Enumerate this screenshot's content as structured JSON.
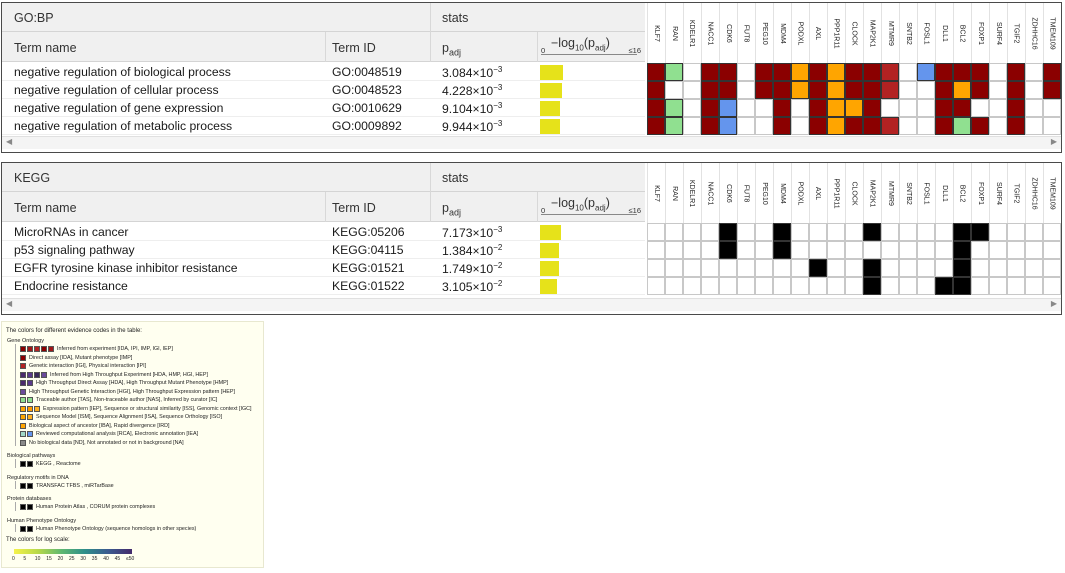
{
  "genes": [
    "KLF7",
    "RAN",
    "KDELR1",
    "NACC1",
    "CDK6",
    "FUT8",
    "PEG10",
    "MDM4",
    "PODXL",
    "AXL",
    "PPP1R11",
    "CLOCK",
    "MAP2K1",
    "MTMR9",
    "SNTB2",
    "FOSL1",
    "DLL1",
    "BCL2",
    "FOXP1",
    "SURF4",
    "TGIF2",
    "ZDHHC16",
    "TMEM109"
  ],
  "columns": {
    "term_name": "Term name",
    "term_id": "Term ID",
    "padj": "p",
    "padj_sub": "adj",
    "log_prefix": "−log",
    "log_sub": "10",
    "log_mid": "(p",
    "log_sub2": "adj",
    "log_suffix": ")",
    "axis_zero": "0",
    "axis_max": "≤16"
  },
  "go_panel": {
    "source": "GO:BP",
    "stats": "stats",
    "rows": [
      {
        "name": "negative regulation of biological process",
        "id": "GO:0048519",
        "p_mant": "3.084×10",
        "p_exp": "−3",
        "log10p": 2.51
      },
      {
        "name": "negative regulation of cellular process",
        "id": "GO:0048523",
        "p_mant": "4.228×10",
        "p_exp": "−3",
        "log10p": 2.37
      },
      {
        "name": "negative regulation of gene expression",
        "id": "GO:0010629",
        "p_mant": "9.104×10",
        "p_exp": "−3",
        "log10p": 2.04
      },
      {
        "name": "negative regulation of metabolic process",
        "id": "GO:0009892",
        "p_mant": "9.944×10",
        "p_exp": "−3",
        "log10p": 2.0
      }
    ],
    "grid": [
      [
        "#8b0000",
        "#90e090",
        "#ffffff",
        "#8b0000",
        "#8b0000",
        "#ffffff",
        "#8b0000",
        "#8b0000",
        "#ffa500",
        "#8b0000",
        "#ffa500",
        "#8b0000",
        "#8b0000",
        "#b22222",
        "#ffffff",
        "#6495ed",
        "#8b0000",
        "#8b0000",
        "#8b0000",
        "#ffffff",
        "#8b0000",
        "#ffffff",
        "#8b0000"
      ],
      [
        "#8b0000",
        "#ffffff",
        "#ffffff",
        "#8b0000",
        "#8b0000",
        "#ffffff",
        "#8b0000",
        "#8b0000",
        "#ffa500",
        "#8b0000",
        "#ffa500",
        "#8b0000",
        "#8b0000",
        "#b22222",
        "#ffffff",
        "#ffffff",
        "#8b0000",
        "#ffa500",
        "#8b0000",
        "#ffffff",
        "#8b0000",
        "#ffffff",
        "#8b0000"
      ],
      [
        "#8b0000",
        "#90e090",
        "#ffffff",
        "#8b0000",
        "#6495ed",
        "#ffffff",
        "#ffffff",
        "#8b0000",
        "#ffffff",
        "#8b0000",
        "#ffa500",
        "#ffa500",
        "#8b0000",
        "#ffffff",
        "#ffffff",
        "#ffffff",
        "#8b0000",
        "#8b0000",
        "#ffffff",
        "#ffffff",
        "#8b0000",
        "#ffffff",
        "#ffffff"
      ],
      [
        "#8b0000",
        "#90e090",
        "#ffffff",
        "#8b0000",
        "#6495ed",
        "#ffffff",
        "#ffffff",
        "#8b0000",
        "#ffffff",
        "#8b0000",
        "#ffa500",
        "#8b0000",
        "#8b0000",
        "#b22222",
        "#ffffff",
        "#ffffff",
        "#8b0000",
        "#90e090",
        "#8b0000",
        "#ffffff",
        "#8b0000",
        "#ffffff",
        "#ffffff"
      ]
    ]
  },
  "kegg_panel": {
    "source": "KEGG",
    "stats": "stats",
    "rows": [
      {
        "name": "MicroRNAs in cancer",
        "id": "KEGG:05206",
        "p_mant": "7.173×10",
        "p_exp": "−3",
        "log10p": 2.14
      },
      {
        "name": "p53 signaling pathway",
        "id": "KEGG:04115",
        "p_mant": "1.384×10",
        "p_exp": "−2",
        "log10p": 1.86
      },
      {
        "name": "EGFR tyrosine kinase inhibitor resistance",
        "id": "KEGG:01521",
        "p_mant": "1.749×10",
        "p_exp": "−2",
        "log10p": 1.76
      },
      {
        "name": "Endocrine resistance",
        "id": "KEGG:01522",
        "p_mant": "3.105×10",
        "p_exp": "−2",
        "log10p": 1.51
      }
    ],
    "grid": [
      [
        "#ffffff",
        "#ffffff",
        "#ffffff",
        "#ffffff",
        "#000000",
        "#ffffff",
        "#ffffff",
        "#000000",
        "#ffffff",
        "#ffffff",
        "#ffffff",
        "#ffffff",
        "#000000",
        "#ffffff",
        "#ffffff",
        "#ffffff",
        "#ffffff",
        "#000000",
        "#000000",
        "#ffffff",
        "#ffffff",
        "#ffffff",
        "#ffffff"
      ],
      [
        "#ffffff",
        "#ffffff",
        "#ffffff",
        "#ffffff",
        "#000000",
        "#ffffff",
        "#ffffff",
        "#000000",
        "#ffffff",
        "#ffffff",
        "#ffffff",
        "#ffffff",
        "#ffffff",
        "#ffffff",
        "#ffffff",
        "#ffffff",
        "#ffffff",
        "#000000",
        "#ffffff",
        "#ffffff",
        "#ffffff",
        "#ffffff",
        "#ffffff"
      ],
      [
        "#ffffff",
        "#ffffff",
        "#ffffff",
        "#ffffff",
        "#ffffff",
        "#ffffff",
        "#ffffff",
        "#ffffff",
        "#ffffff",
        "#000000",
        "#ffffff",
        "#ffffff",
        "#000000",
        "#ffffff",
        "#ffffff",
        "#ffffff",
        "#ffffff",
        "#000000",
        "#ffffff",
        "#ffffff",
        "#ffffff",
        "#ffffff",
        "#ffffff"
      ],
      [
        "#ffffff",
        "#ffffff",
        "#ffffff",
        "#ffffff",
        "#ffffff",
        "#ffffff",
        "#ffffff",
        "#ffffff",
        "#ffffff",
        "#ffffff",
        "#ffffff",
        "#ffffff",
        "#000000",
        "#ffffff",
        "#ffffff",
        "#ffffff",
        "#000000",
        "#000000",
        "#ffffff",
        "#ffffff",
        "#ffffff",
        "#ffffff",
        "#ffffff"
      ]
    ]
  },
  "legend": {
    "title": "The colors for different evidence codes in the table:",
    "groups": [
      {
        "name": "Gene Ontology",
        "items": [
          {
            "colors": [
              "#8b0000",
              "#a01818",
              "#b22222",
              "#8b0000",
              "#a01818"
            ],
            "label": "Inferred from experiment [IDA, IPI, IMP, IGI, IEP]"
          },
          {
            "colors": [
              "#8b0000"
            ],
            "label": "Direct assay [IDA], Mutant phenotype [IMP]"
          },
          {
            "colors": [
              "#b22222"
            ],
            "label": "Genetic interaction [IGI], Physical interaction [IPI]"
          },
          {
            "colors": [
              "#4b2a6b",
              "#5a3a8a",
              "#3b2a5b",
              "#6a4a9a"
            ],
            "label": "Inferred from High Throughput Experiment [HDA, HMP, HGI, HEP]"
          },
          {
            "colors": [
              "#4b2a6b",
              "#5a3a8a"
            ],
            "label": "High Throughput Direct Assay [HDA], High Throughput Mutant Phenotype [HMP]"
          },
          {
            "colors": [
              "#6a4a9a"
            ],
            "label": "High Throughput Genetic Interaction [HGI], High Throughput Expression pattern [HEP]"
          },
          {
            "colors": [
              "#90e090",
              "#90e090"
            ],
            "label": "Traceable author [TAS], Non-traceable author [NAS], Inferred by curator [IC]"
          },
          {
            "colors": [
              "#ffa500",
              "#ff9a00",
              "#ffb020"
            ],
            "label": "Expression pattern [IEP], Sequence or structural similarity [ISS], Genomic context [IGC]"
          },
          {
            "colors": [
              "#ffa500",
              "#ffb020"
            ],
            "label": "Sequence Model [ISM], Sequence Alignment [ISA], Sequence Orthology [ISO]"
          },
          {
            "colors": [
              "#ffa500"
            ],
            "label": "Biological aspect of ancestor [IBA], Rapid divergence [IRD]"
          },
          {
            "colors": [
              "#a0d8c8",
              "#6495ed"
            ],
            "label": "Reviewed computational analysis [RCA], Electronic annotation [IEA]"
          },
          {
            "colors": [
              "#8a8a8a"
            ],
            "label": "No biological data [ND], Not annotated or not in background [NA]"
          }
        ]
      },
      {
        "name": "Biological pathways",
        "items": [
          {
            "colors": [
              "#000000",
              "#000000"
            ],
            "label": "KEGG , Reactome"
          }
        ]
      },
      {
        "name": "Regulatory motifs in DNA",
        "items": [
          {
            "colors": [
              "#000000",
              "#000000"
            ],
            "label": "TRANSFAC TFBS , miRTarBase"
          }
        ]
      },
      {
        "name": "Protein databases",
        "items": [
          {
            "colors": [
              "#000000",
              "#000000"
            ],
            "label": "Human Protein Atlas , CORUM protein complexes"
          }
        ]
      },
      {
        "name": "Human Phenotype Ontology",
        "items": [
          {
            "colors": [
              "#000000",
              "#000000"
            ],
            "label": "Human Phenotype Ontology (sequence homologs in other species)"
          }
        ]
      }
    ],
    "scale_title": "The colors for log scale:",
    "scale_ticks": [
      "0",
      "5",
      "10",
      "15",
      "20",
      "25",
      "30",
      "35",
      "40",
      "45",
      "≤50"
    ]
  }
}
